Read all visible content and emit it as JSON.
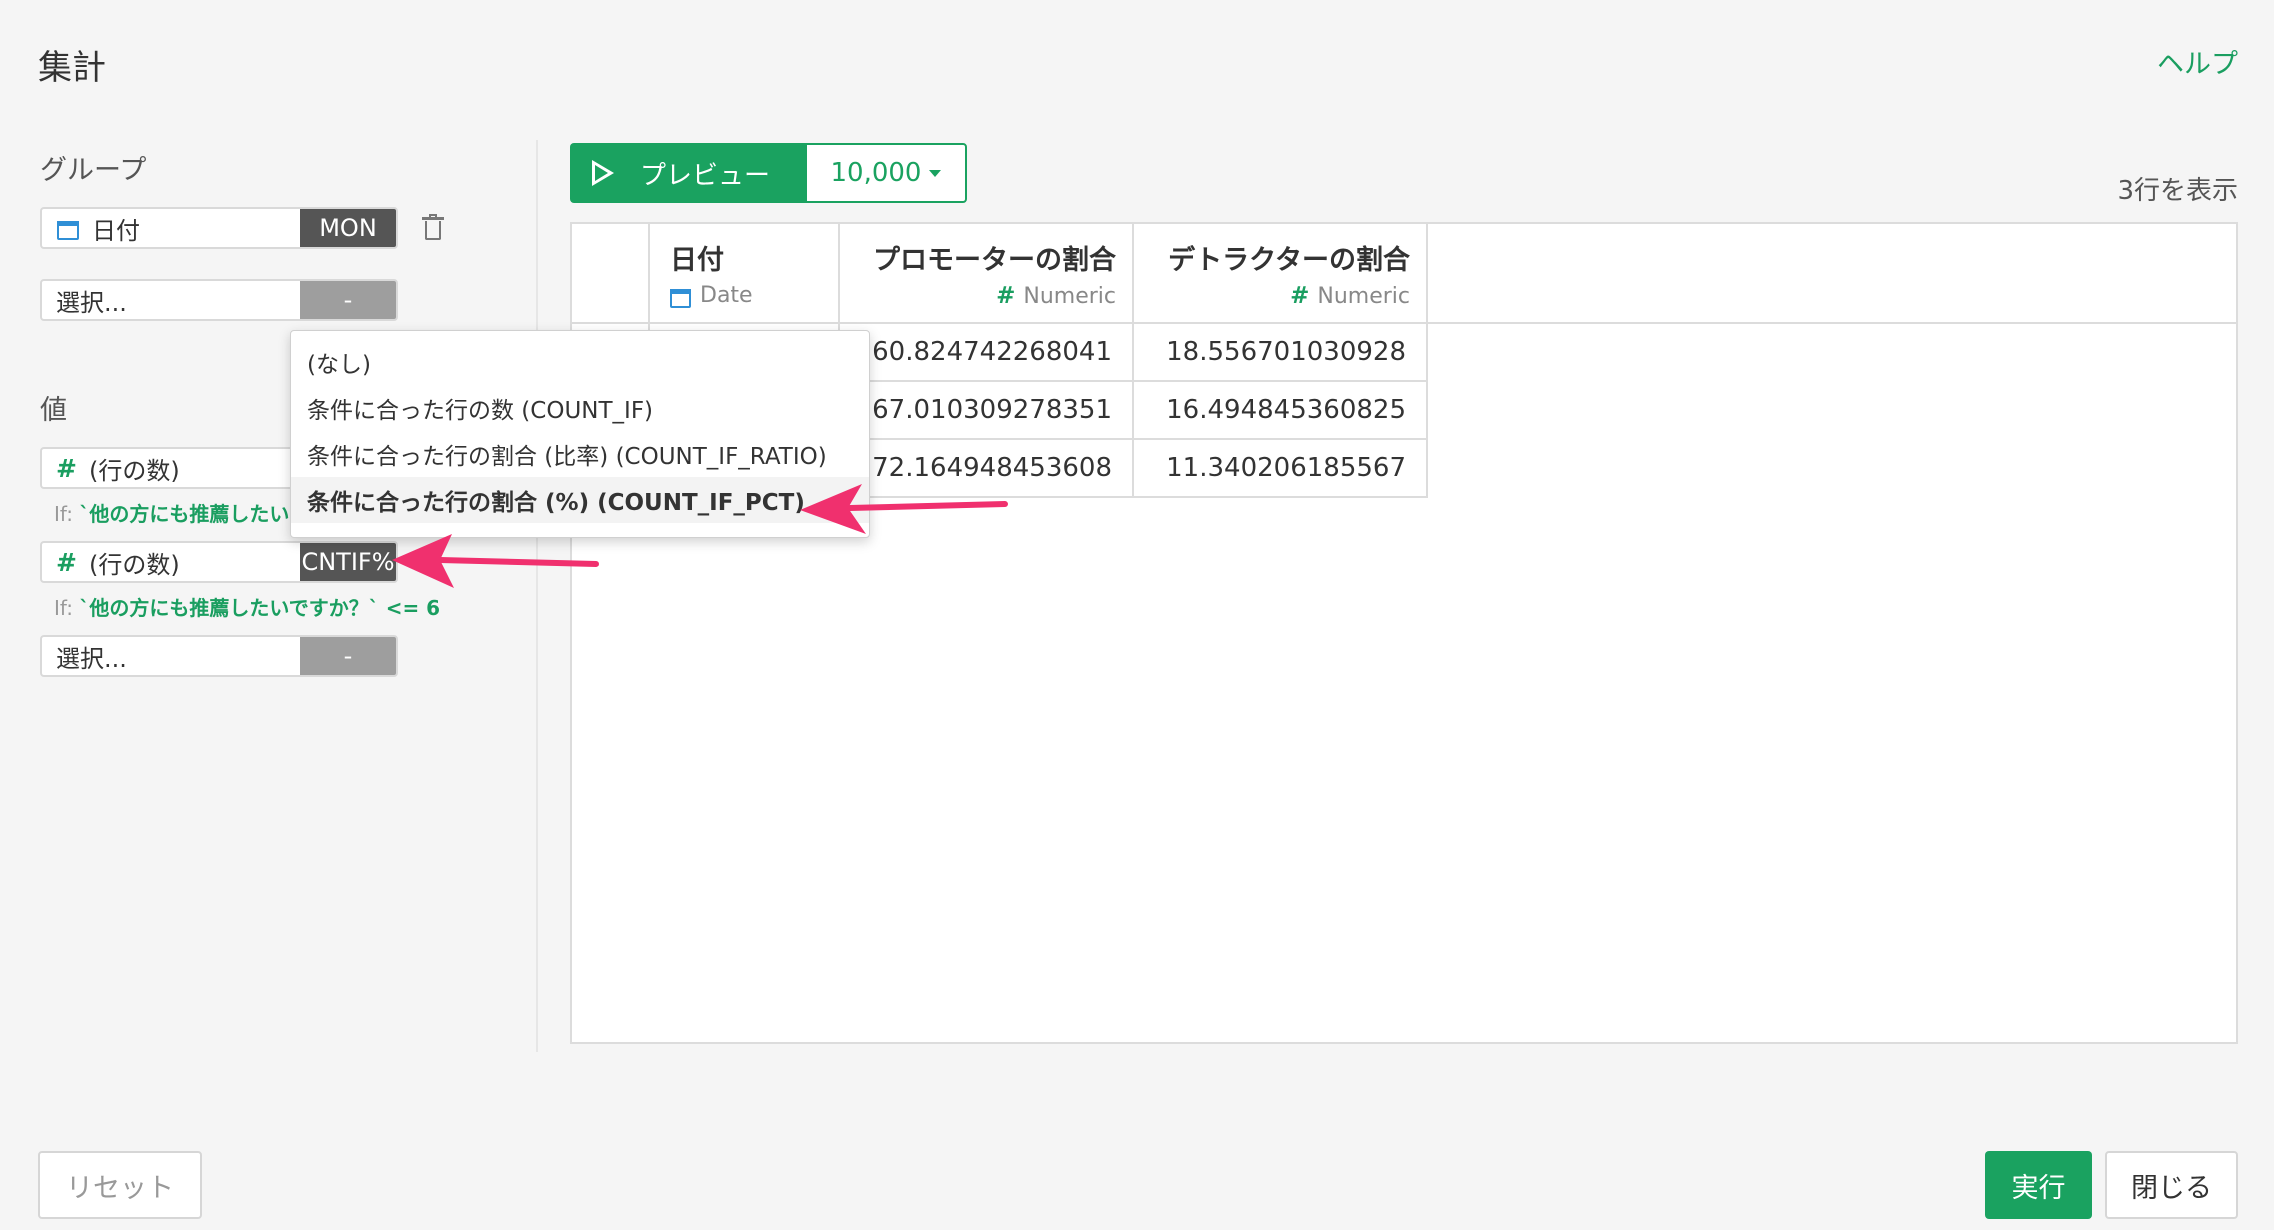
{
  "header": {
    "title": "集計",
    "help": "ヘルプ"
  },
  "group": {
    "label": "グループ",
    "fields": [
      {
        "name": "日付",
        "function": "MON",
        "icon": "calendar-icon"
      },
      {
        "name": "選択...",
        "function": "-"
      }
    ]
  },
  "values": {
    "label": "値",
    "fields": [
      {
        "name": "(行の数)",
        "function": "",
        "condition_prefix": "If:",
        "condition": "`他の方にも推薦したい"
      },
      {
        "name": "(行の数)",
        "function": "CNTIF%",
        "condition_prefix": "If:",
        "condition": "`他の方にも推薦したいですか？` <= 6"
      },
      {
        "name": "選択...",
        "function": "-"
      }
    ]
  },
  "menu": {
    "items": [
      "(なし)",
      "条件に合った行の数 (COUNT_IF)",
      "条件に合った行の割合 (比率) (COUNT_IF_RATIO)",
      "条件に合った行の割合 (%) (COUNT_IF_PCT)"
    ],
    "selected_index": 3
  },
  "preview": {
    "button": "プレビュー",
    "rows": "10,000",
    "row_count": "3行を表示"
  },
  "table": {
    "columns": [
      {
        "name": "日付",
        "type": "Date",
        "type_icon": "calendar-icon"
      },
      {
        "name": "プロモーターの割合",
        "type": "Numeric",
        "type_icon": "hash-icon"
      },
      {
        "name": "デトラクターの割合",
        "type": "Numeric",
        "type_icon": "hash-icon"
      }
    ],
    "rows": [
      [
        "",
        "60.824742268041",
        "18.556701030928"
      ],
      [
        "",
        "67.010309278351",
        "16.494845360825"
      ],
      [
        "",
        "72.164948453608",
        "11.340206185567"
      ]
    ]
  },
  "footer": {
    "reset": "リセット",
    "run": "実行",
    "close": "閉じる"
  },
  "colors": {
    "accent": "#1aa260",
    "arrow": "#f0306e",
    "function_bg": "#555555"
  }
}
